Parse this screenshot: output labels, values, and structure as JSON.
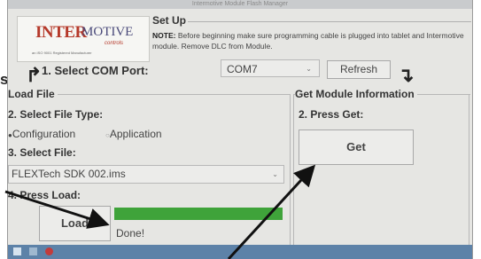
{
  "window": {
    "title": "Intermotive Module Flash Manager"
  },
  "logo": {
    "brand_part1": "INTER",
    "brand_part2": "MOTIVE",
    "brand_part3": "controls",
    "tagline": "an ISO 9001 Registered Manufacturer"
  },
  "setup": {
    "title": "Set Up",
    "note_label": "NOTE:",
    "note_text": "Before beginning make sure programming cable is plugged into tablet and Intermotive module. Remove DLC from Module."
  },
  "com": {
    "label": "1. Select COM Port:",
    "selected": "COM7",
    "refresh_label": "Refresh"
  },
  "load_file": {
    "title": "Load File",
    "step2_label": "2. Select File Type:",
    "radio_configuration": "Configuration",
    "radio_application": "Application",
    "step3_label": "3. Select File:",
    "file_selected": "FLEXTech SDK 002.ims",
    "step4_label": "4. Press Load:",
    "load_button": "Load",
    "progress": 1.0,
    "status": "Done!"
  },
  "module_info": {
    "title": "Get Module Information",
    "step2_label": "2. Press Get:",
    "get_button": "Get"
  },
  "cutoff_text": "s",
  "colors": {
    "progress": "#3fa33a",
    "brand_red": "#b5392a",
    "taskbar": "#5d82a8"
  }
}
